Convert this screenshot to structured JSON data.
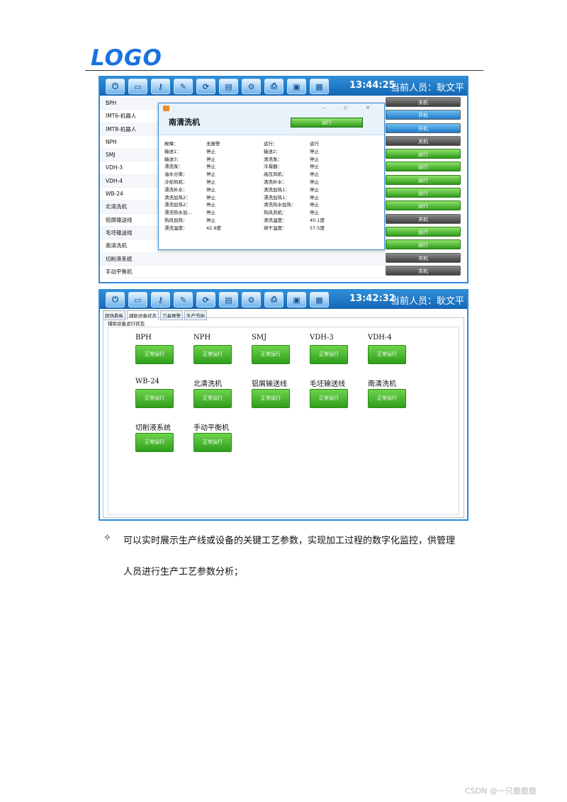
{
  "logo_text": "LOGO",
  "screenshot1": {
    "time": "13:44:25",
    "current_user": "当前人员：耿文平",
    "devices": [
      "BPH",
      "IMT6-机器人",
      "IMT8-机器人",
      "NPH",
      "SMJ",
      "VDH-3",
      "VDH-4",
      "WB-24",
      "北清洗机",
      "铝屑输送线",
      "毛坯输送线",
      "南清洗机",
      "切削液系统",
      "手动平衡机"
    ],
    "status_buttons": [
      "关机",
      "开机",
      "开机",
      "关机",
      "运行",
      "运行",
      "运行",
      "运行",
      "运行",
      "关机",
      "运行",
      "运行",
      "关机",
      "关机"
    ],
    "dialog": {
      "window_controls": "– ▫ ×",
      "title": "南清洗机",
      "run_button": "运行",
      "rows": [
        [
          "故障：",
          "无报警",
          "运行：",
          "运行"
        ],
        [
          "输送1：",
          "停止",
          "输送2：",
          "停止"
        ],
        [
          "输送3：",
          "停止",
          "清洗泵：",
          "停止"
        ],
        [
          "漂洗泵：",
          "停止",
          "冷凝器：",
          "停止"
        ],
        [
          "油水分离：",
          "停止",
          "高压风机：",
          "停止"
        ],
        [
          "冷却风机：",
          "停止",
          "清洗补水：",
          "停止"
        ],
        [
          "漂洗补水：",
          "停止",
          "清洗加热1：",
          "停止"
        ],
        [
          "清洗加热2：",
          "停止",
          "漂洗加热1：",
          "停止"
        ],
        [
          "漂洗加热2：",
          "停止",
          "清洗热水加热：",
          "停止"
        ],
        [
          "漂洗热水加...",
          "停止",
          "热风风机：",
          "停止"
        ],
        [
          "热风加热：",
          "停止",
          "清洗温度：",
          "40.1度"
        ],
        [
          "漂洗温度：",
          "42.9度",
          "烘干温度：",
          "57.5度"
        ]
      ]
    }
  },
  "screenshot2": {
    "time": "13:42:32",
    "current_user": "当前人员：耿文平",
    "tabs": [
      "现场看板",
      "辅助设备状态",
      "刀具报警",
      "生产节拍"
    ],
    "panel_title": "辅助设备运行状态",
    "equipment": [
      {
        "name": "BPH",
        "status": "正常运行"
      },
      {
        "name": "NPH",
        "status": "正常运行"
      },
      {
        "name": "SMJ",
        "status": "正常运行"
      },
      {
        "name": "VDH-3",
        "status": "正常运行"
      },
      {
        "name": "VDH-4",
        "status": "正常运行"
      },
      {
        "name": "WB-24",
        "status": "正常运行"
      },
      {
        "name": "北清洗机",
        "status": "正常运行"
      },
      {
        "name": "铝屑输送线",
        "status": "正常运行"
      },
      {
        "name": "毛坯输送线",
        "status": "正常运行"
      },
      {
        "name": "南清洗机",
        "status": "正常运行"
      },
      {
        "name": "切削液系统",
        "status": "正常运行"
      },
      {
        "name": "手动平衡机",
        "status": "正常运行"
      }
    ]
  },
  "bullet_symbol": "✧",
  "paragraph_line1": "可以实时展示生产线或设备的关键工艺参数，实现加工过程的数字化监控，供管理",
  "paragraph_line2": "人员进行生产工艺参数分析；",
  "footer_watermark": "CSDN @一只鹿鹿鹿"
}
